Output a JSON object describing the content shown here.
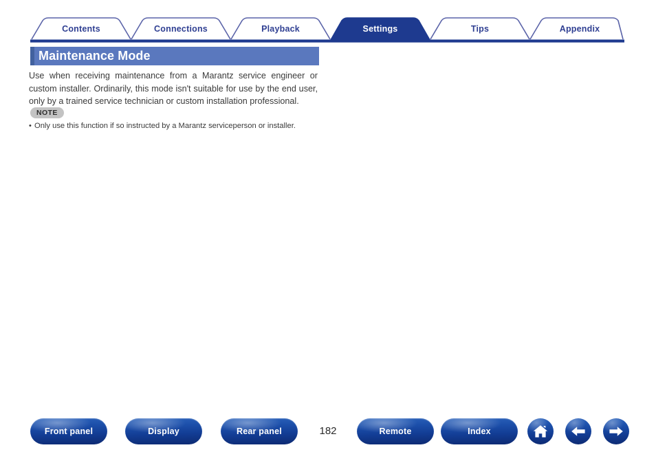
{
  "tabs": [
    {
      "label": "Contents",
      "active": false
    },
    {
      "label": "Connections",
      "active": false
    },
    {
      "label": "Playback",
      "active": false
    },
    {
      "label": "Settings",
      "active": true
    },
    {
      "label": "Tips",
      "active": false
    },
    {
      "label": "Appendix",
      "active": false
    }
  ],
  "page": {
    "title": "Maintenance Mode",
    "body": "Use when receiving maintenance from a Marantz service engineer or custom installer. Ordinarily, this mode isn't suitable for use by the end user, only by a trained service technician or custom installation professional.",
    "note_badge": "NOTE",
    "note_items": [
      "Only use this function if so instructed by a Marantz serviceperson or installer."
    ]
  },
  "footer": {
    "buttons": [
      {
        "label": "Front panel"
      },
      {
        "label": "Display"
      },
      {
        "label": "Rear panel"
      },
      {
        "label": "Remote"
      },
      {
        "label": "Index"
      }
    ],
    "page_number": "182",
    "icons": [
      {
        "name": "home-icon"
      },
      {
        "name": "arrow-left-icon"
      },
      {
        "name": "arrow-right-icon"
      }
    ]
  },
  "colors": {
    "tab_active_fill": "#1e3a8f",
    "tab_inactive_text": "#2f3f92",
    "tab_border": "#5a63a8",
    "tab_underline": "#1e3a8f",
    "title_bar": "#5a78be",
    "title_accent": "#42619f",
    "note_badge_bg": "#c3c3c3",
    "button_blue": "#1c4faa",
    "text": "#3a3a3a"
  }
}
